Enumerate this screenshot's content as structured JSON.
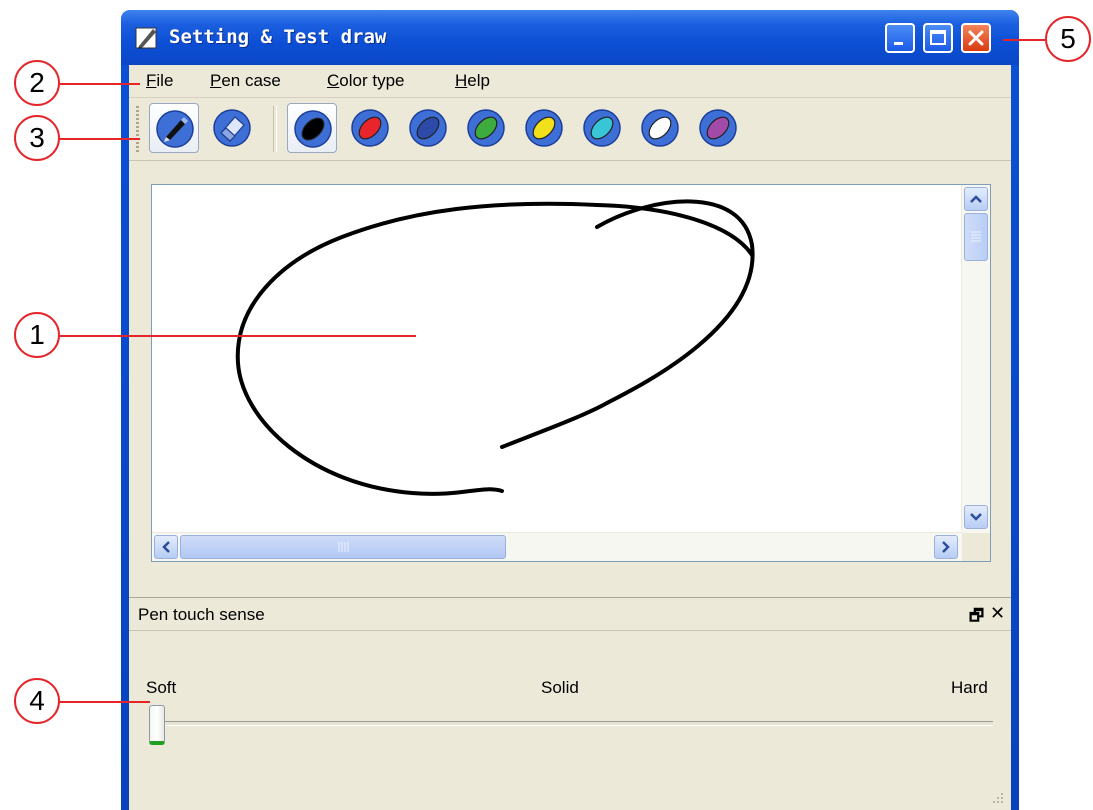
{
  "window": {
    "title": "Setting & Test draw",
    "minimize_label": "minimize",
    "maximize_label": "maximize",
    "close_label": "close"
  },
  "menu": {
    "items": [
      {
        "mnemonic": "F",
        "rest": "ile"
      },
      {
        "mnemonic": "P",
        "rest": "en case"
      },
      {
        "mnemonic": "C",
        "rest": "olor type"
      },
      {
        "mnemonic": "H",
        "rest": "elp"
      }
    ]
  },
  "toolbar": {
    "tools": [
      {
        "name": "pen-icon",
        "pressed": true
      },
      {
        "name": "eraser-icon",
        "pressed": false
      }
    ],
    "colors": [
      {
        "name": "black",
        "hex": "#000000",
        "pressed": true
      },
      {
        "name": "red",
        "hex": "#e8252b",
        "pressed": false
      },
      {
        "name": "blue",
        "hex": "#2c4aa8",
        "pressed": false
      },
      {
        "name": "green",
        "hex": "#3dab3d",
        "pressed": false
      },
      {
        "name": "yellow",
        "hex": "#f2e11a",
        "pressed": false
      },
      {
        "name": "cyan",
        "hex": "#38c6d6",
        "pressed": false
      },
      {
        "name": "white",
        "hex": "#ffffff",
        "pressed": false
      },
      {
        "name": "purple",
        "hex": "#a24aa8",
        "pressed": false
      }
    ]
  },
  "pen_touch_panel": {
    "title": "Pen touch sense",
    "float_glyph": "🗗",
    "close_glyph": "✕",
    "labels": {
      "soft": "Soft",
      "solid": "Solid",
      "hard": "Hard"
    },
    "value": 0.0
  },
  "callouts": [
    "1",
    "2",
    "3",
    "4",
    "5"
  ],
  "colors": {
    "accent": "#e4262a",
    "titlebar": "#0a47c6",
    "client": "#ece9d8"
  }
}
